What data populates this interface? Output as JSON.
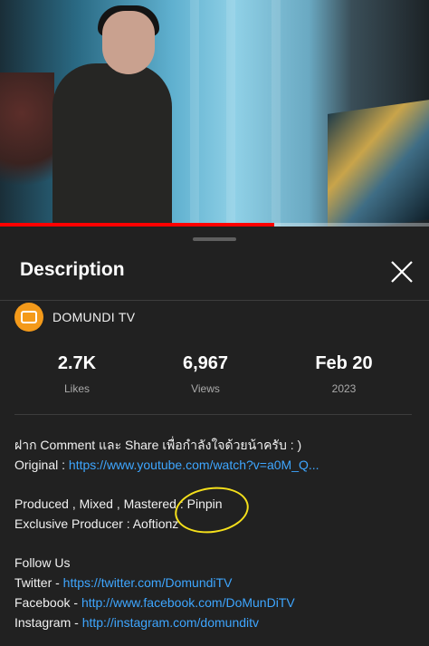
{
  "video": {
    "progress_fraction": 0.64
  },
  "panel": {
    "title": "Description",
    "close_icon": "close-icon"
  },
  "channel": {
    "name": "DOMUNDI TV",
    "avatar_color": "#f49a1a"
  },
  "stats": [
    {
      "value": "2.7K",
      "label": "Likes"
    },
    {
      "value": "6,967",
      "label": "Views"
    },
    {
      "value": "Feb 20",
      "label": "2023"
    }
  ],
  "description": {
    "line1": "ฝาก Comment และ Share เพื่อกำลังใจด้วยน้าครับ : )",
    "original_prefix": "Original : ",
    "original_link": "https://www.youtube.com/watch?v=a0M_Q...",
    "produced": "Produced , Mixed , Mastered : Pinpin",
    "exclusive": "Exclusive Producer : Aoftionz",
    "follow": "Follow Us",
    "twitter_prefix": "Twitter - ",
    "twitter_link": "https://twitter.com/DomundiTV",
    "facebook_prefix": "Facebook - ",
    "facebook_link": "http://www.facebook.com/DoMunDiTV",
    "instagram_prefix": "Instagram - ",
    "instagram_link": "http://instagram.com/domunditv"
  },
  "colors": {
    "background": "#212121",
    "link": "#3ea6ff",
    "progress": "#ff0000",
    "annotation": "#f5e01b"
  }
}
